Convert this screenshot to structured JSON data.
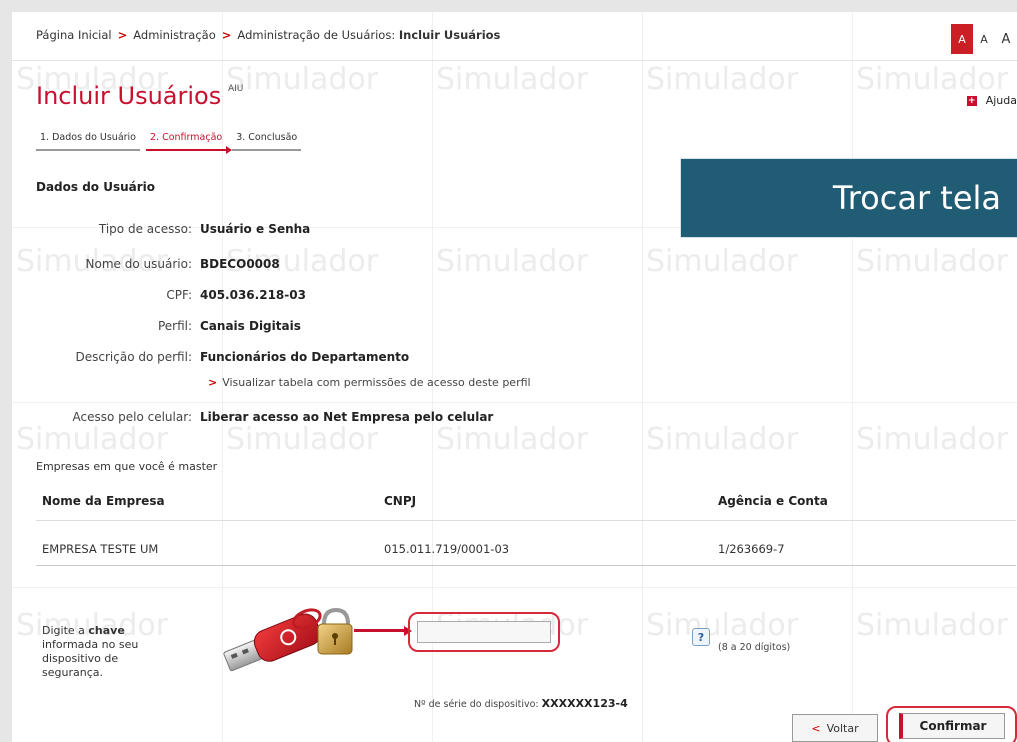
{
  "breadcrumb": {
    "home": "Página Inicial",
    "admin": "Administração",
    "user_admin": "Administração de Usuários:",
    "current": "Incluir Usuários",
    "separator": ">"
  },
  "font_size_controls": [
    "A",
    "A",
    "A"
  ],
  "watermark_text": "Simulador",
  "title": "Incluir Usuários",
  "title_code": "AIU",
  "help_label": "Ajuda",
  "steps": [
    {
      "label": "1. Dados do Usuário",
      "active": false
    },
    {
      "label": "2. Confirmação",
      "active": true
    },
    {
      "label": "3. Conclusão",
      "active": false
    }
  ],
  "section_title": "Dados do Usuário",
  "trocar_tela_label": "Trocar tela",
  "fields": [
    {
      "label": "Tipo de acesso:",
      "value": "Usuário e Senha"
    },
    {
      "label": "Nome do usuário:",
      "value": "BDECO0008"
    },
    {
      "label": "CPF:",
      "value": "405.036.218-03"
    },
    {
      "label": "Perfil:",
      "value": "Canais Digitais"
    },
    {
      "label": "Descrição do perfil:",
      "value": "Funcionários do Departamento"
    },
    {
      "label": "Acesso pelo celular:",
      "value": "Liberar acesso ao Net Empresa pelo celular"
    }
  ],
  "permissions_link": "Visualizar tabela com permissões de acesso deste perfil",
  "companies_title": "Empresas em que você é master",
  "table": {
    "headers": [
      "Nome da Empresa",
      "CNPJ",
      "Agência e Conta"
    ],
    "rows": [
      [
        "EMPRESA TESTE UM",
        "015.011.719/0001-03",
        "1/263669-7"
      ]
    ]
  },
  "key_prompt": {
    "prefix": "Digite a ",
    "bold": "chave",
    "suffix": " informada no seu dispositivo de segurança."
  },
  "key_input": {
    "value": "",
    "placeholder": ""
  },
  "digits_hint": "(8 a 20 dígitos)",
  "serial_label": "Nº de série do dispositivo:",
  "serial_value": "XXXXXX123-4",
  "buttons": {
    "back": "Voltar",
    "confirm": "Confirmar"
  },
  "colors": {
    "brand_red": "#c8102e",
    "overlay_blue": "#215c75"
  }
}
